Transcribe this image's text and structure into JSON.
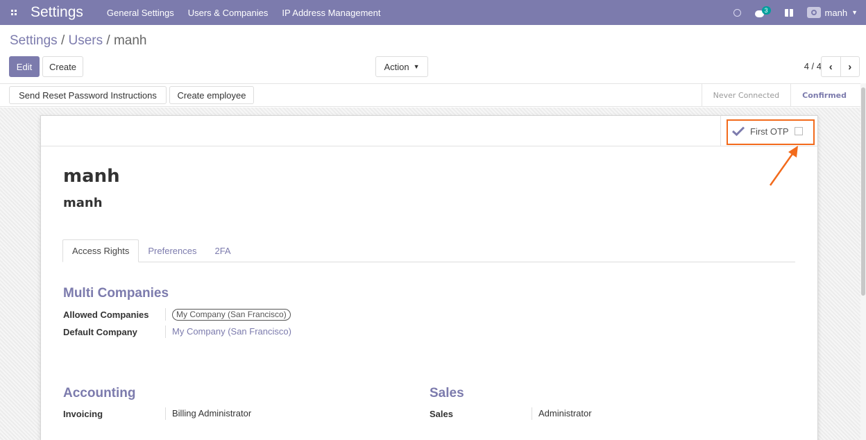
{
  "navbar": {
    "brand": "Settings",
    "menu": [
      "General Settings",
      "Users & Companies",
      "IP Address Management"
    ],
    "chat_badge": "3",
    "user_name": "manh"
  },
  "breadcrumb": {
    "parts": [
      "Settings",
      "Users"
    ],
    "separator": "/",
    "current": "manh"
  },
  "control": {
    "edit_label": "Edit",
    "create_label": "Create",
    "action_label": "Action",
    "pager_text": "4 / 4"
  },
  "header_buttons": {
    "reset_password": "Send Reset Password Instructions",
    "create_employee": "Create employee"
  },
  "status": {
    "steps": [
      "Never Connected",
      "Confirmed"
    ],
    "active": "Confirmed"
  },
  "smart_button": {
    "label": "First OTP",
    "checked": false
  },
  "user": {
    "name": "manh",
    "login": "manh"
  },
  "tabs": [
    "Access Rights",
    "Preferences",
    "2FA"
  ],
  "multi_companies": {
    "title": "Multi Companies",
    "allowed_label": "Allowed Companies",
    "allowed_value": "My Company (San Francisco)",
    "default_label": "Default Company",
    "default_value": "My Company (San Francisco)"
  },
  "accounting": {
    "title": "Accounting",
    "field_label": "Invoicing",
    "field_value": "Billing Administrator"
  },
  "sales": {
    "title": "Sales",
    "field_label": "Sales",
    "field_value": "Administrator"
  },
  "colors": {
    "primary": "#7c7bad",
    "annotation": "#f26a1b"
  }
}
